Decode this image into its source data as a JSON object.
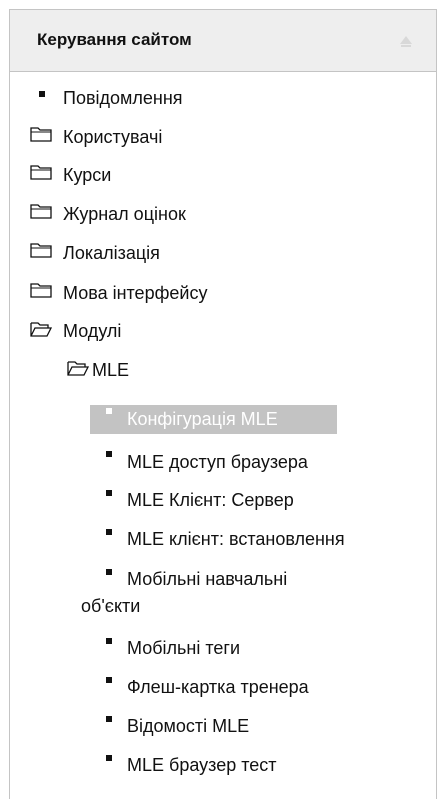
{
  "block": {
    "title": "Керування сайтом",
    "items": [
      {
        "label": "Повідомлення"
      },
      {
        "label": "Користувачі"
      },
      {
        "label": "Курси"
      },
      {
        "label": "Журнал оцінок"
      },
      {
        "label": "Локалізація"
      },
      {
        "label": "Мова інтерфейсу"
      },
      {
        "label": "Модулі"
      },
      {
        "label": "MLE"
      },
      {
        "label": "Конфігурація MLE"
      },
      {
        "label": "MLE доступ браузера"
      },
      {
        "label": "MLE Клієнт: Сервер"
      },
      {
        "label": "MLE клієнт: встановлення"
      },
      {
        "label_line1": "Мобільні навчальні",
        "label_line2": "об'єкти"
      },
      {
        "label": "Мобільні теги"
      },
      {
        "label": "Флеш-картка тренера"
      },
      {
        "label": "Відомості MLE"
      },
      {
        "label": "MLE браузер тест"
      }
    ]
  },
  "icons": {
    "bullet": "bullet-icon",
    "folder_closed": "folder-closed-icon",
    "folder_open": "folder-open-icon",
    "collapse": "collapse-icon"
  },
  "colors": {
    "selected_bg": "#c3c3c3",
    "header_bg": "#eeeeee"
  }
}
